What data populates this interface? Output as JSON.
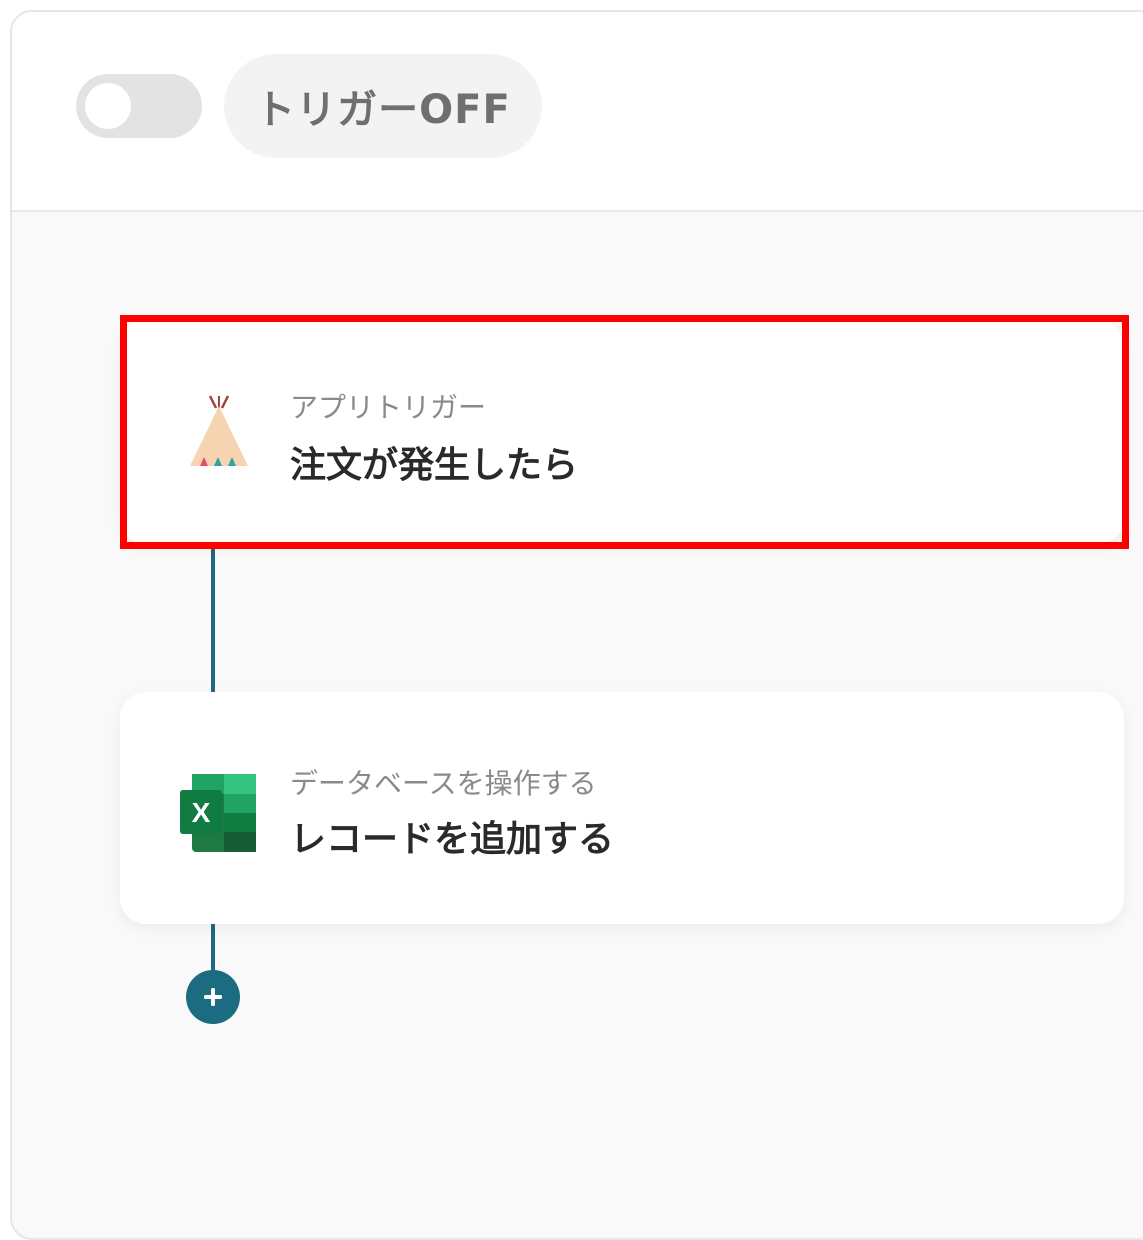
{
  "header": {
    "trigger_toggle_state": "off",
    "trigger_label": "トリガーOFF"
  },
  "flow": {
    "steps": [
      {
        "subtitle": "アプリトリガー",
        "title": "注文が発生したら",
        "icon": "tent-app-icon",
        "highlighted": true,
        "highlight_color": "#ff0000"
      },
      {
        "subtitle": "データベースを操作する",
        "title": "レコードを追加する",
        "icon": "excel-icon",
        "highlighted": false
      }
    ],
    "add_step_icon": "plus-icon",
    "accent_color": "#1b6c80"
  }
}
